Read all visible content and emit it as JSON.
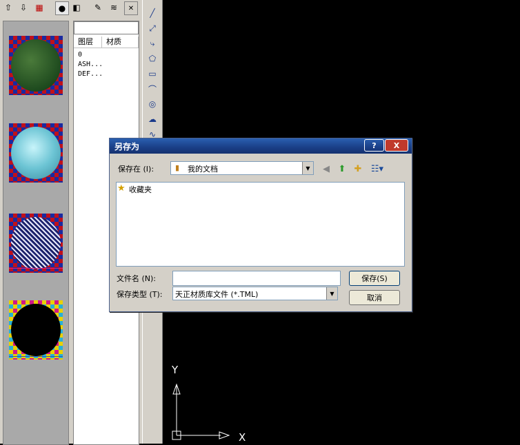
{
  "material_panel": {
    "toolbar_icons": [
      "arrow-up-icon",
      "arrow-down-icon",
      "grid-icon",
      "sphere-icon",
      "cube-icon",
      "eyedropper-icon",
      "layers-icon",
      "close-icon"
    ],
    "layer_list": {
      "headers": [
        "图层",
        "材质"
      ],
      "rows": [
        "0",
        "ASH...",
        "DEF..."
      ]
    }
  },
  "canvas": {
    "axis_y": "Y",
    "axis_x": "X"
  },
  "dialog": {
    "title": "另存为",
    "help_button": "?",
    "close_button": "X",
    "save_in_label": "保存在 (I):",
    "save_in_value": "我的文档",
    "files": [
      {
        "name": "收藏夹"
      }
    ],
    "filename_label": "文件名 (N):",
    "filename_value": "",
    "filetype_label": "保存类型 (T):",
    "filetype_value": "天正材质库文件 (*.TML)",
    "save_button": "保存(S)",
    "cancel_button": "取消"
  },
  "colors": {
    "titlebar": "#1a3e86",
    "canvas_bg": "#000000",
    "panel_bg": "#d4d0c8"
  }
}
